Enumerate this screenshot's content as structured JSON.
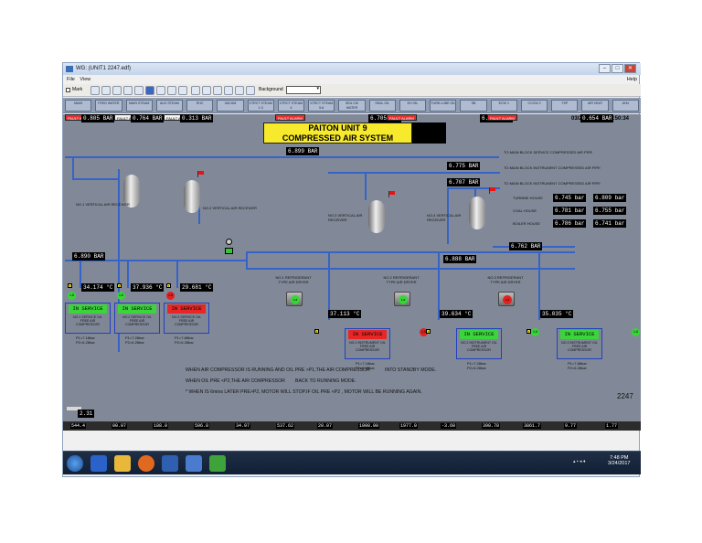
{
  "window": {
    "title": "WG: (UNIT1 2247.edf)",
    "min": "–",
    "max": "□",
    "close": "✕"
  },
  "menu": {
    "file": "File",
    "view": "View",
    "help": "Help"
  },
  "toolbar": {
    "mark_label": "Mark",
    "background_label": "Background"
  },
  "nav": [
    "MAIN",
    "FEED WATER",
    "MAIN STEAM",
    "AUX STEAM",
    "EHC",
    "VACUM",
    "XTRCT STEAM 1-3",
    "XTRCT STEAM 4",
    "XTRCT STEAM 5-6",
    "SEA CW WATER",
    "SEAL OIL",
    "EH OIL",
    "TURB LUBE OIL",
    "SB",
    "ECW 1",
    "CCCW 2",
    "TSP",
    "AIR HEAT",
    "AHU"
  ],
  "header": {
    "date": "03/24/17",
    "time": "18:50:34",
    "title_line1": "PAITON UNIT 9",
    "title_line2": "COMPRESSED AIR SYSTEM"
  },
  "readings": {
    "main_header": "6.899",
    "unit_bar": "BAR",
    "air_rcv": "6.775",
    "instr_1": "6.707",
    "left_hdr": "6.890",
    "mid_hdr": "6.888",
    "right_hdr": "6.762",
    "turbine_a": "6.745",
    "turbine_b": "6.809",
    "coal_a": "6.781",
    "coal_b": "6.755",
    "boiler_a": "6.786",
    "boiler_b": "6.741",
    "bar_short": "bar"
  },
  "lines": {
    "service_main": "TO MAIN BLOCK SERVICE COMPRESSED AIR PIPE",
    "instr_main1": "TO MAIN BLOCK INSTRUMENT COMPRESSED AIR PIPE",
    "instr_main2": "TO MAIN BLOCK INSTRUMENT COMPRESSED AIR PIPE",
    "turbine_house": "TURBINE HOUSE",
    "coal_house": "COAL HOUSE",
    "boiler_house": "BOILER HOUSE"
  },
  "receivers": {
    "r1": "NO.1 VERTICAL AIR RECEIVER",
    "r2": "NO.2 VERTICAL AIR RECEIVER",
    "r3": "NO.3 VERTICAL AIR RECEIVER",
    "r4": "NO.4 VERTICAL AIR RECEIVER"
  },
  "dryers": {
    "d1": "NO.1 REFRIGERANT TYPE AIR DRYER",
    "d2": "NO.2 REFRIGERANT TYPE AIR DRYER",
    "d3": "NO.3 REFRIGERANT TYPE AIR DRYER"
  },
  "compressors": [
    {
      "alarm": "FAULT ALARM",
      "temp": "34.174",
      "press": "0.805",
      "status": "IN SERVICE",
      "name": "NO.1 SERVICE OIL FREE AIR COMPRESSOR",
      "p1": "P1=7.18bar",
      "p2": "P2=6.28bar"
    },
    {
      "alarm": "FAULT ALARM",
      "temp": "37.936",
      "press": "0.764",
      "status": "IN SERVICE",
      "name": "NO.2 SERVICE OIL FREE AIR COMPRESSOR",
      "p1": "P1=7.28bar",
      "p2": "P2=6.28bar"
    },
    {
      "alarm": "FAULT ALARM",
      "temp": "29.681",
      "press": "0.313",
      "status": "IN SERVICE",
      "name": "NO.3 SERVICE OIL FREE AIR COMPRESSOR",
      "p1": "P1=7.88bar",
      "p2": "P2=6.28bar"
    },
    {
      "alarm": "FAULT ALARM",
      "temp": "37.113",
      "press": "6.705",
      "status": "IN SERVICE",
      "name": "NO.1 INSTRUMENT OIL FREE AIR COMPRESSOR",
      "p1": "P1=7.18bar",
      "p2": "P2=6.28bar"
    },
    {
      "alarm": "FAULT ALARM",
      "temp": "39.634",
      "press": "6.856",
      "status": "IN SERVICE",
      "name": "NO.2 INSTRUMENT OIL FREE AIR COMPRESSOR",
      "p1": "P1=7.28bar",
      "p2": "P2=6.28bar"
    },
    {
      "alarm": "FAULT ALARM",
      "temp": "35.035",
      "press": "0.654",
      "status": "IN SERVICE",
      "name": "NO.3 INSTRUMENT OIL FREE AIR COMPRESSOR",
      "p1": "P1=7.88bar",
      "p2": "P2=6.28bar"
    }
  ],
  "units": {
    "degc": "°C",
    "bar": "BAR"
  },
  "ind_text": "1-8",
  "notes": {
    "l1a": "WHEN AIR COMPRESSOR IS RUNNING AND OIL PRE >P1,THE AIR COMPRESSOR",
    "l1b": "INTO STANDBY MODE.",
    "l2a": "WHEN OIL PRE <P2,THE AIR COMPRESSOR",
    "l2b": "BACK TO RUNNING MODE.",
    "l3a": "* WHEN IS 6mins LATER PRE>P2, MOTOR WILL STOP.",
    "l3b": "IF OIL PRE <P2 , MOTOR WILL BE RUNNING AGAIN."
  },
  "page_num": "2247",
  "small_val": "2.31",
  "status_bar": [
    "544.4",
    "00.07",
    "188.0",
    "596.8",
    "34.97",
    "537.62",
    "20.07",
    "1008.00",
    "1977.0",
    "-3.60",
    "390.78",
    "3861.7",
    "9.77",
    "1.77"
  ],
  "taskbar": {
    "time": "7:48 PM",
    "date": "3/24/2017"
  }
}
